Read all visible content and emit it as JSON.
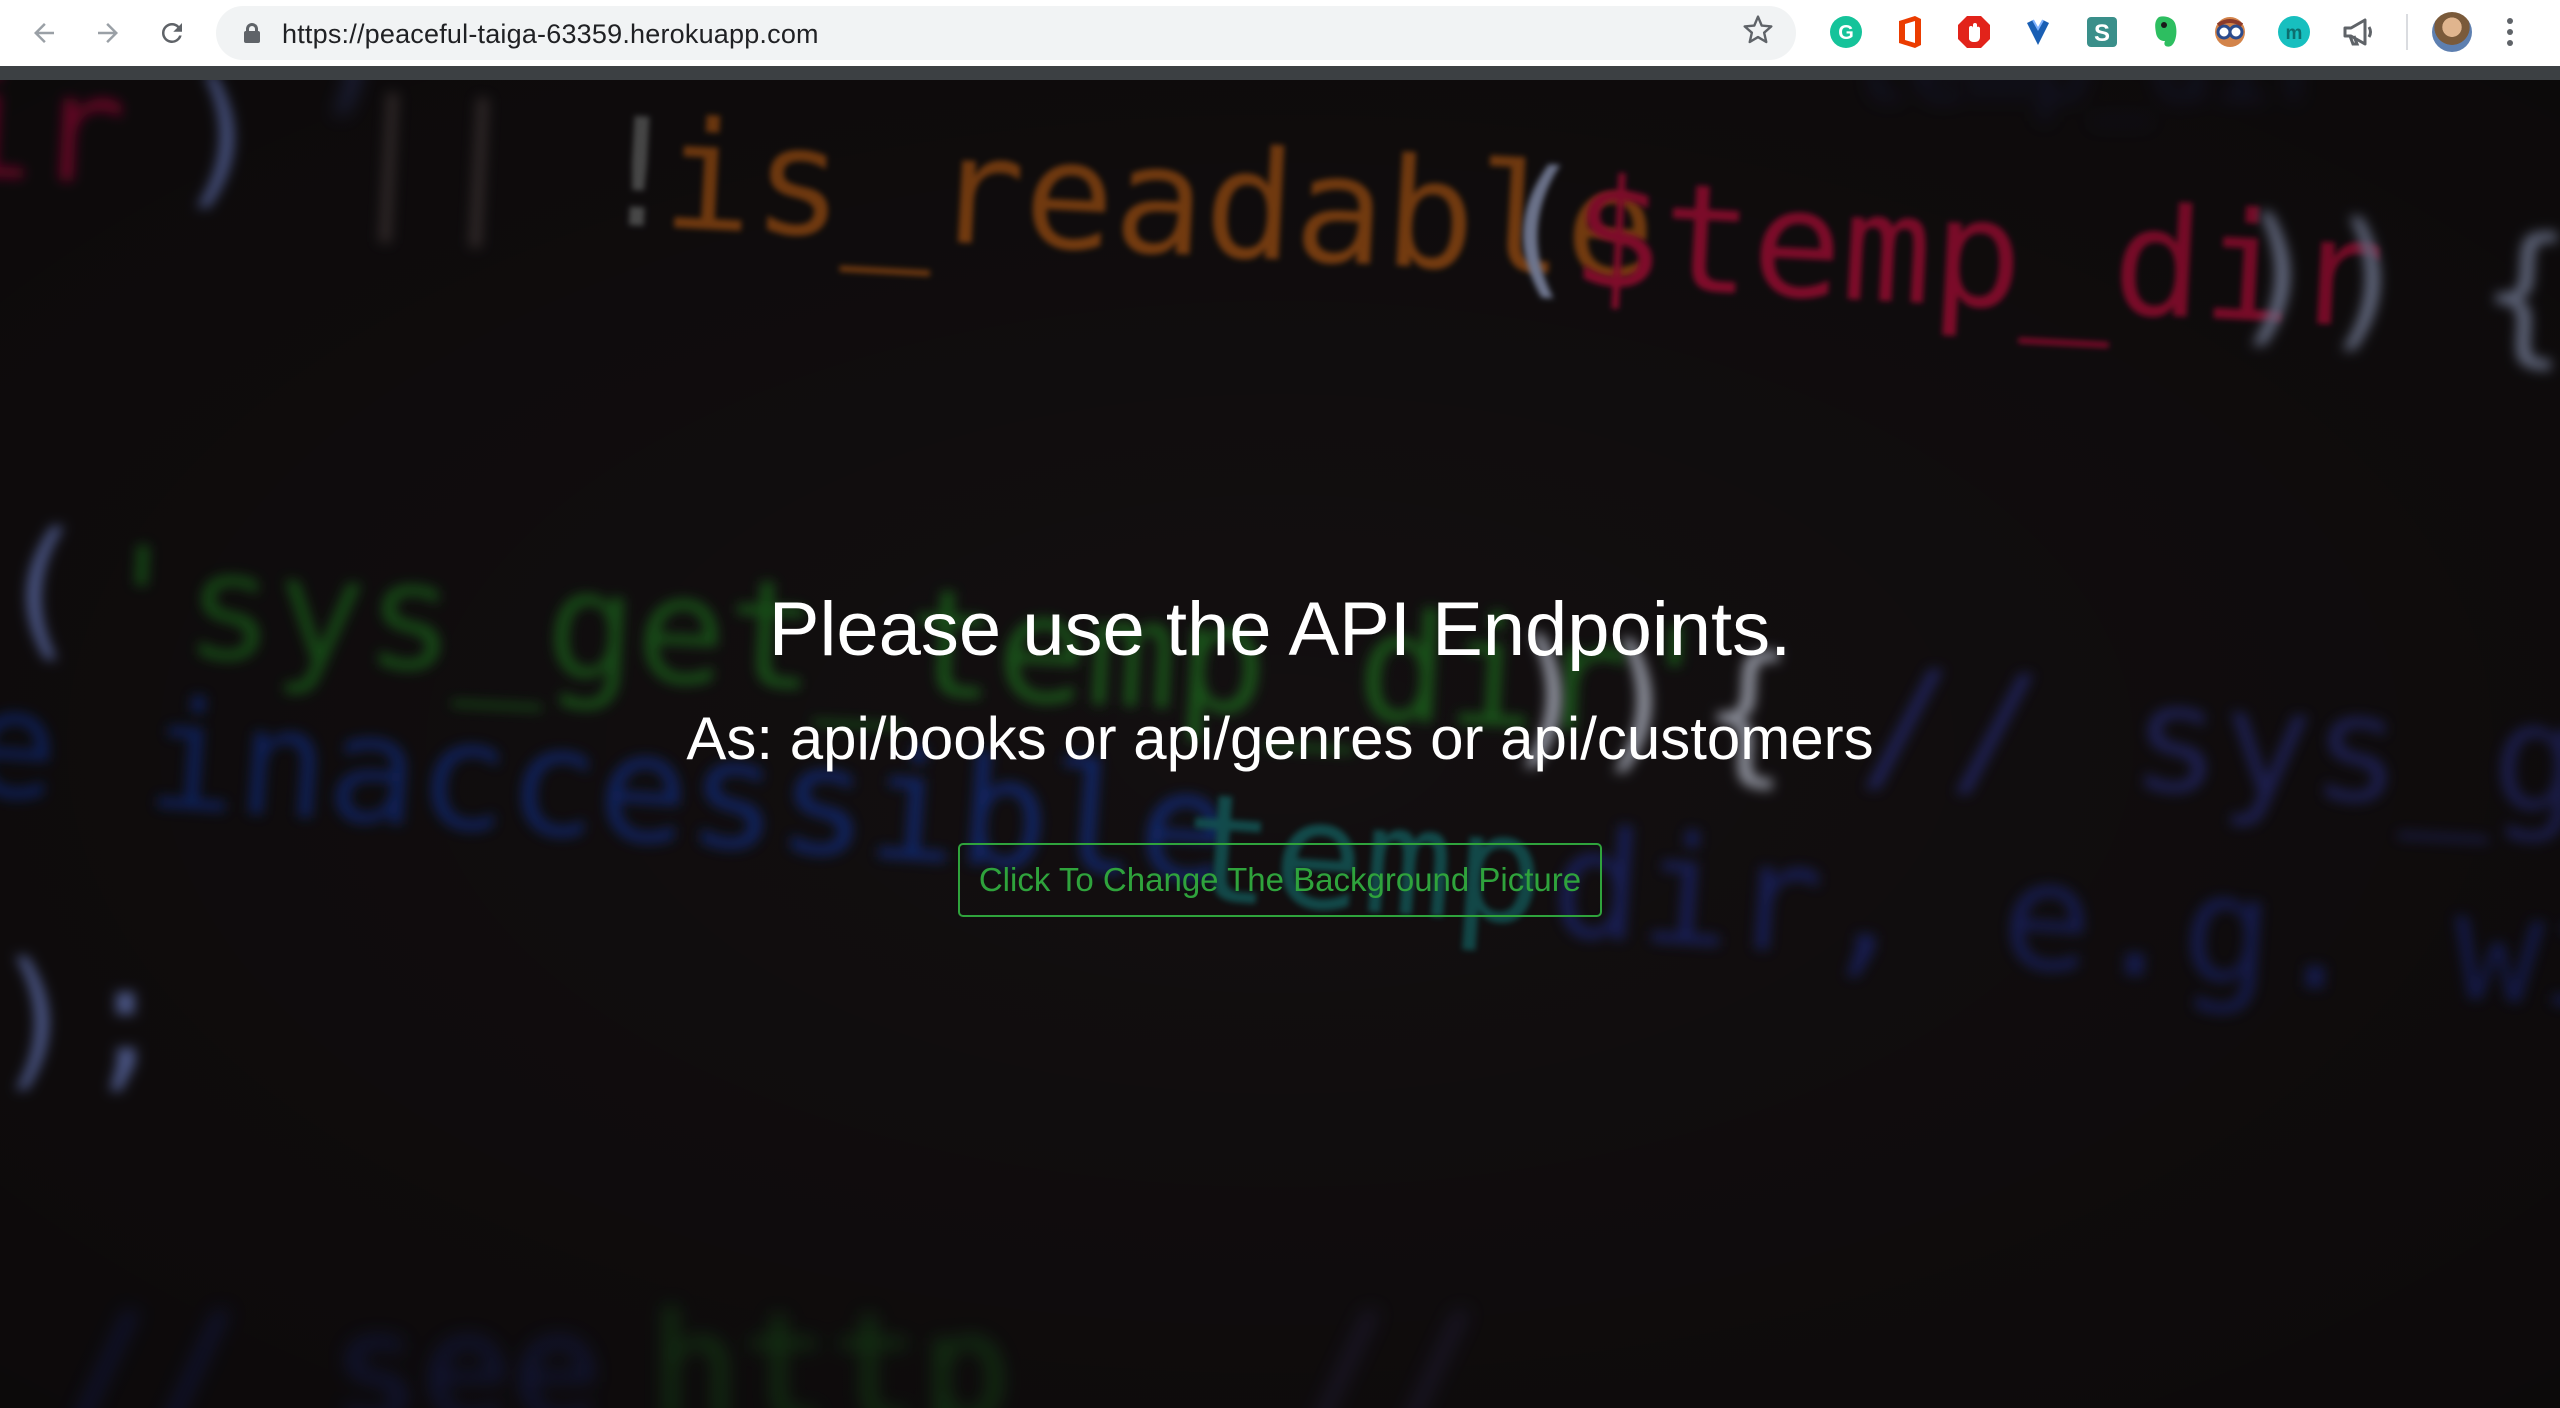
{
  "browser": {
    "url": "https://peaceful-taiga-63359.herokuapp.com",
    "nav_icons": [
      "back-arrow-icon",
      "forward-arrow-icon",
      "reload-icon"
    ],
    "extensions": [
      {
        "name": "grammarly-extension-icon",
        "glyph": "G",
        "color": "#15c39a"
      },
      {
        "name": "office-extension-icon",
        "glyph": "",
        "color": "#eb3c00"
      },
      {
        "name": "adblock-extension-icon",
        "glyph": "",
        "color": "#e2231a"
      },
      {
        "name": "heart-extension-icon",
        "glyph": "",
        "color": "#1a73e8"
      },
      {
        "name": "s-extension-icon",
        "glyph": "S",
        "color": "#3a8f8a"
      },
      {
        "name": "evernote-extension-icon",
        "glyph": "",
        "color": "#2dbe60"
      },
      {
        "name": "mask-extension-icon",
        "glyph": "",
        "color": "#c0392b"
      },
      {
        "name": "m-extension-icon",
        "glyph": "m",
        "color": "#17bfbf"
      },
      {
        "name": "megaphone-extension-icon",
        "glyph": "",
        "color": "#5f6368"
      }
    ]
  },
  "main": {
    "headline": "Please use the API Endpoints.",
    "subline": "As: api/books or api/genres or api/customers",
    "change_background_button": "Click To Change The Background Picture"
  },
  "colors": {
    "button_accent": "#2fa33c",
    "page_background": "#1c1719"
  }
}
